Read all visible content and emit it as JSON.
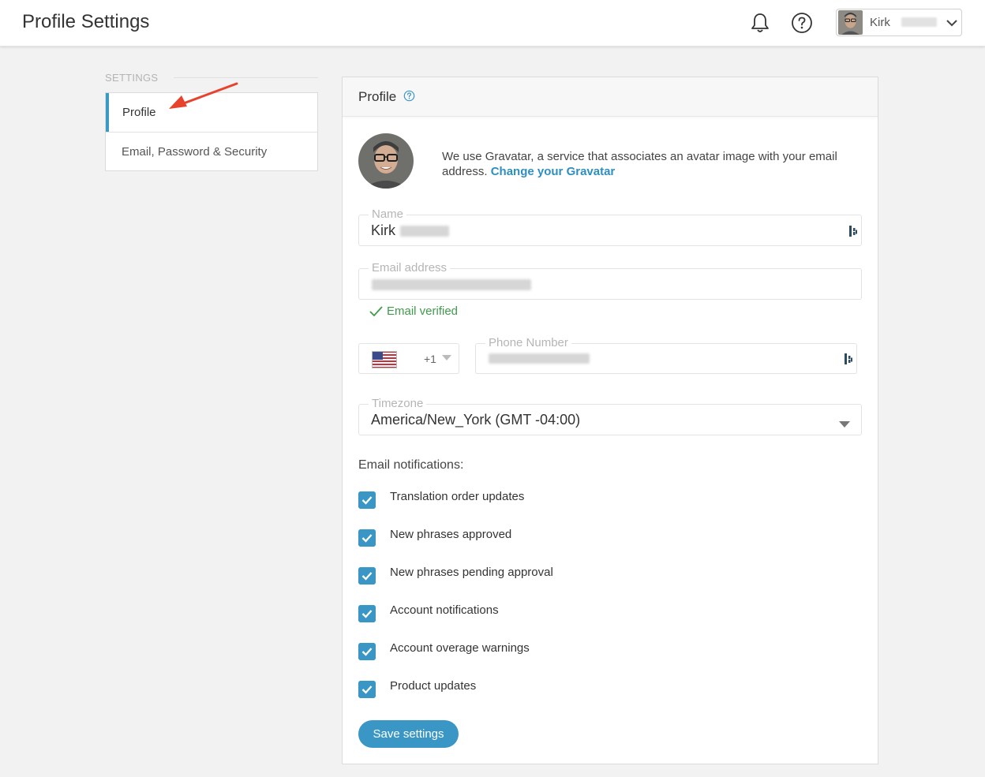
{
  "header": {
    "title": "Profile Settings",
    "user_name": "Kirk",
    "icons": [
      "bell-icon",
      "help-circle-icon",
      "chevron-down-icon"
    ]
  },
  "sidebar": {
    "section_label": "SETTINGS",
    "items": [
      {
        "label": "Profile",
        "active": true
      },
      {
        "label": "Email, Password & Security",
        "active": false
      }
    ]
  },
  "profile": {
    "title": "Profile",
    "gravatar_text": "We use Gravatar, a service that associates an avatar image with your email address.",
    "gravatar_link": "Change your Gravatar",
    "name_label": "Name",
    "name_value": "Kirk",
    "email_label": "Email address",
    "email_status": "Email verified",
    "country_code": "+1",
    "phone_label": "Phone Number",
    "timezone_label": "Timezone",
    "timezone_value": "America/New_York (GMT -04:00)",
    "notifications_heading": "Email notifications:",
    "notifications": [
      {
        "label": "Translation order updates",
        "checked": true
      },
      {
        "label": "New phrases approved",
        "checked": true
      },
      {
        "label": "New phrases pending approval",
        "checked": true
      },
      {
        "label": "Account notifications",
        "checked": true
      },
      {
        "label": "Account overage warnings",
        "checked": true
      },
      {
        "label": "Product updates",
        "checked": true
      }
    ],
    "save_label": "Save settings"
  },
  "colors": {
    "accent": "#3a97c5",
    "link": "#2e8fbf",
    "verified": "#3f9b4b",
    "annotation_arrow": "#e8412c"
  }
}
